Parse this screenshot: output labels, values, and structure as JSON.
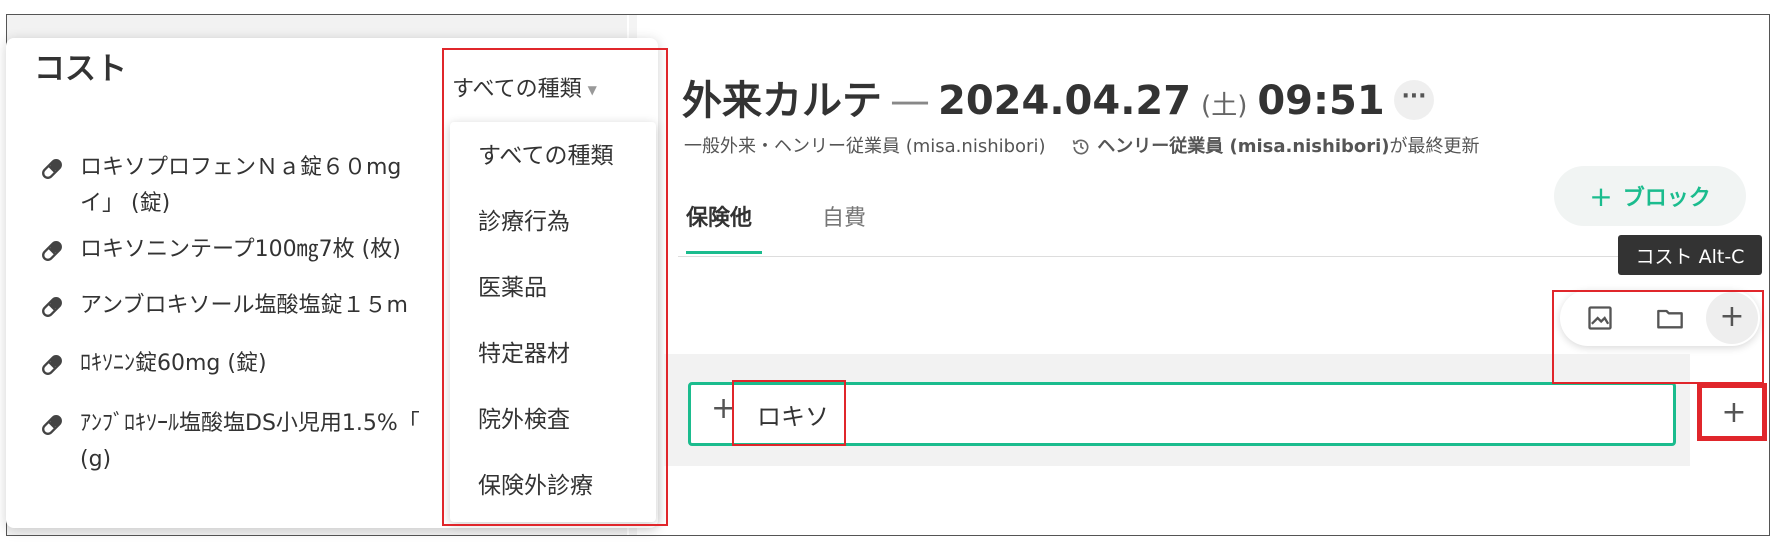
{
  "cost_panel": {
    "title": "コスト",
    "type_select_value": "すべての種類",
    "items": [
      {
        "label": "ロキソプロフェンＮａ錠６０mg\nイ」 (錠)"
      },
      {
        "label": "ロキソニンテープ100㎎7枚 (枚)"
      },
      {
        "label": "アンブロキソール塩酸塩錠１５m"
      },
      {
        "label": "ﾛｷｿﾆﾝ錠60mg (錠)"
      },
      {
        "label": "ｱﾝﾌﾞﾛｷｿｰﾙ塩酸塩DS小児用1.5%「\n(g)"
      }
    ],
    "dropdown_options": [
      "すべての種類",
      "診療行為",
      "医薬品",
      "特定器材",
      "院外検査",
      "保険外診療"
    ]
  },
  "chart": {
    "title_prefix": "外来カルテ",
    "dash": "—",
    "date": "2024.04.27",
    "day_of_week": "(土)",
    "time": "09:51",
    "more_label": "···",
    "subtitle_left": "一般外来・ヘンリー従業員 (misa.nishibori)",
    "updated_by": "ヘンリー従業員 (misa.nishibori)",
    "updated_suffix": "が最終更新",
    "tabs": [
      {
        "label": "保険他",
        "active": true
      },
      {
        "label": "自費",
        "active": false
      }
    ],
    "block_button_label": "ブロック",
    "tooltip": "コスト Alt-C",
    "entry_value": "ロキソ"
  },
  "colors": {
    "accent": "#1bbc8e",
    "highlight": "#e0262b"
  }
}
